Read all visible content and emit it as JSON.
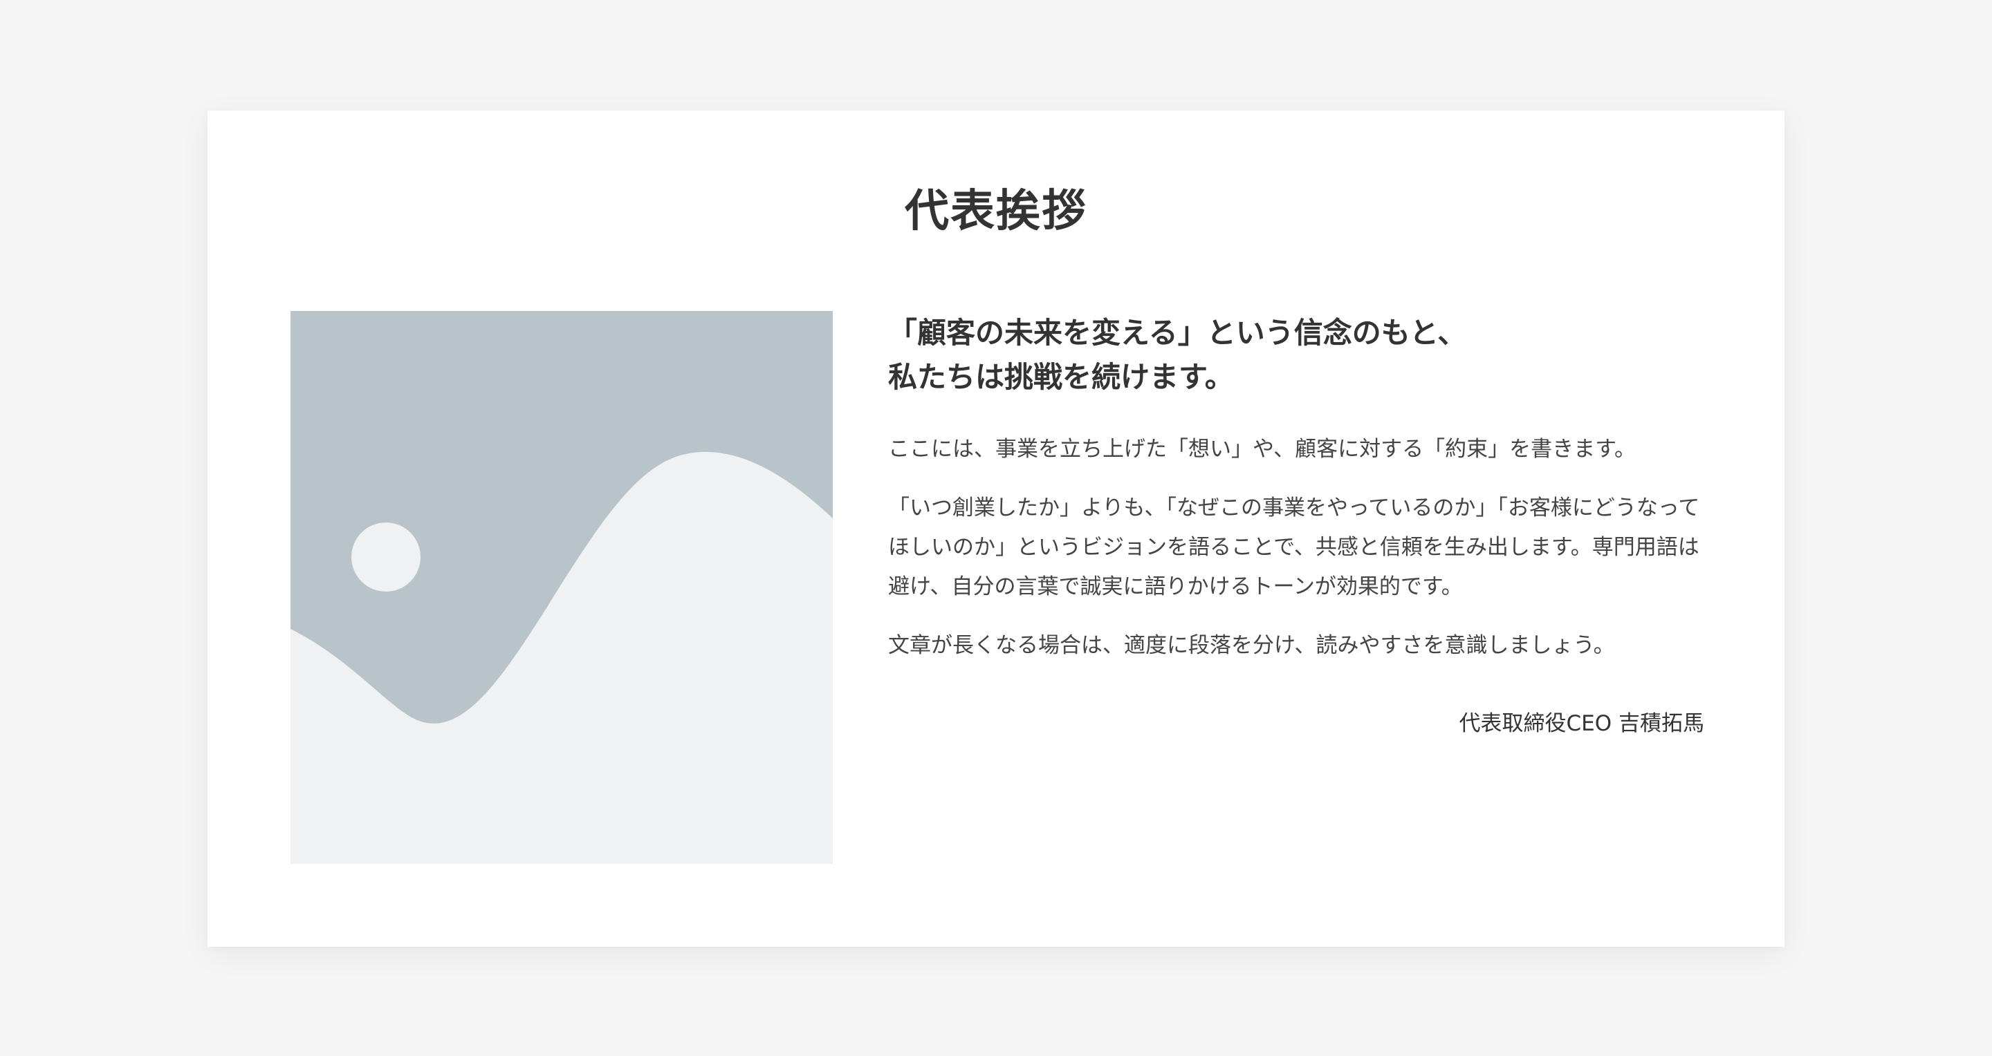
{
  "greeting": {
    "title": "代表挨拶",
    "lead_lines": [
      "「顧客の未来を変える」という信念のもと、",
      "私たちは挑戦を続けます。"
    ],
    "paragraphs": [
      "ここには、事業を立ち上げた「想い」や、顧客に対する「約束」を書きます。",
      "「いつ創業したか」よりも、「なぜこの事業をやっているのか」「お客様にどうなってほしいのか」というビジョンを語ることで、共感と信頼を生み出します。専門用語は避け、自分の言葉で誠実に語りかけるトーンが効果的です。",
      "文章が長くなる場合は、適度に段落を分け、読みやすさを意識しましょう。"
    ],
    "signature": "代表取締役CEO 吉積拓馬",
    "image": {
      "icon": "image-placeholder-icon",
      "colors": {
        "background": "#b9c4ca",
        "foreground": "#eff1f3"
      }
    }
  }
}
